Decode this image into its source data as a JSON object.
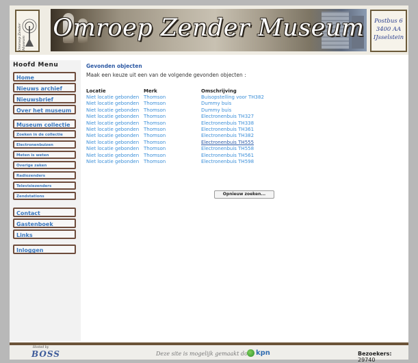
{
  "header": {
    "logo_text": "Omroep Zender Museum",
    "title": "Omroep Zender Museum",
    "address": [
      "Postbus 6",
      "3400 AA",
      "IJsselstein"
    ]
  },
  "sidebar": {
    "heading": "Hoofd Menu",
    "items": [
      "Home",
      "Nieuws archief",
      "Nieuwsbrief",
      "Over het museum",
      "Museum collectie",
      "Zoeken in de collectie",
      "Electronenbuizen",
      "Meten is weten",
      "Overige zaken",
      "Radiozenders",
      "Televisiezenders",
      "Zendstations",
      "Contact",
      "Gastenboek",
      "Links",
      "Inloggen"
    ]
  },
  "main": {
    "heading": "Gevonden objecten",
    "intro": "Maak een keuze uit een van de volgende gevonden objecten :",
    "columns": [
      "Locatie",
      "Merk",
      "Omschrijving"
    ],
    "rows": [
      [
        "Niet locatie gebonden",
        "Thomson",
        "Buisopstelling voor TH382"
      ],
      [
        "Niet locatie gebonden",
        "Thomson",
        "Dummy buis"
      ],
      [
        "Niet locatie gebonden",
        "Thomson",
        "Dummy buis"
      ],
      [
        "Niet locatie gebonden",
        "Thomson",
        "Electronenbuis TH327"
      ],
      [
        "Niet locatie gebonden",
        "Thomson",
        "Electronenbuis TH338"
      ],
      [
        "Niet locatie gebonden",
        "Thomson",
        "Electronenbuis TH361"
      ],
      [
        "Niet locatie gebonden",
        "Thomson",
        "Electronenbuis TH382"
      ],
      [
        "Niet locatie gebonden",
        "Thomson",
        "Electronenbuis TH555"
      ],
      [
        "Niet locatie gebonden",
        "Thomson",
        "Electronenbuis TH558"
      ],
      [
        "Niet locatie gebonden",
        "Thomson",
        "Electronenbuis TH561"
      ],
      [
        "Niet locatie gebonden",
        "Thomson",
        "Electronenbuis TH598"
      ]
    ],
    "search_again": "Opnieuw zoeken..."
  },
  "footer": {
    "hosted_by": "Hosted by",
    "hosting_logo": "BOSS",
    "sponsor_text": "Deze site is mogelijk gemaakt door",
    "sponsor_logo": "kpn",
    "visitors_label": "Bezoekers:",
    "visitors_count": "29740"
  },
  "colors": {
    "link": "#3a8ed8",
    "heading": "#2b58a3",
    "button_border": "#6d4b3b",
    "address_text": "#2b3f8f"
  }
}
